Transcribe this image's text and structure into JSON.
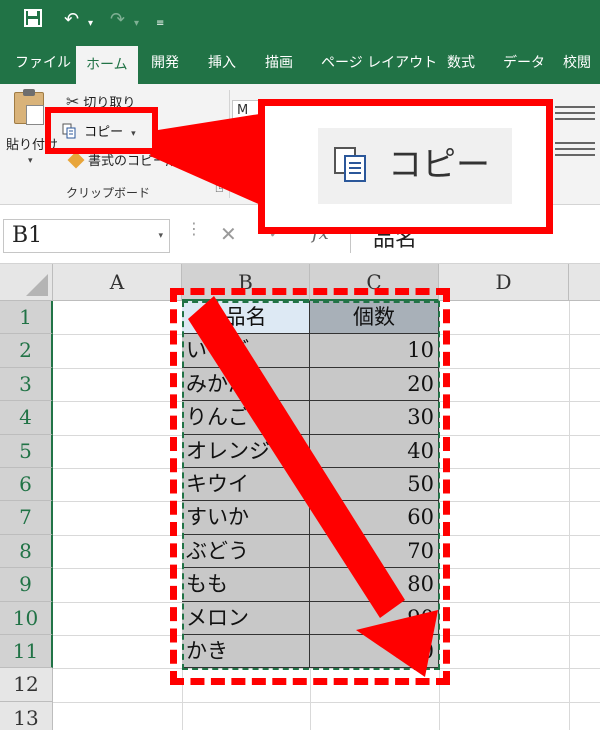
{
  "tabs": [
    "ファイル",
    "ホーム",
    "開発",
    "挿入",
    "描画",
    "ページ レイアウト",
    "数式",
    "データ",
    "校閲"
  ],
  "active_tab": "ホーム",
  "clipboard": {
    "paste_label": "貼り付け",
    "cut_label": "切り取り",
    "copy_label": "コピー",
    "format_painter_label": "書式のコピー/貼り付け",
    "group_label": "クリップボード"
  },
  "font_box_value": "M",
  "callout": {
    "zoom_label": "コピー"
  },
  "formula_bar": {
    "name_box": "B1",
    "fx": "fx",
    "content": "品名"
  },
  "columns": [
    "A",
    "B",
    "C",
    "D"
  ],
  "rows": [
    "1",
    "2",
    "3",
    "4",
    "5",
    "6",
    "7",
    "8",
    "9",
    "10",
    "11",
    "12",
    "13"
  ],
  "table": {
    "headers": [
      "品名",
      "個数"
    ],
    "rows": [
      [
        "いちご",
        "10"
      ],
      [
        "みかん",
        "20"
      ],
      [
        "りんご",
        "30"
      ],
      [
        "オレンジ",
        "40"
      ],
      [
        "キウイ",
        "50"
      ],
      [
        "すいか",
        "60"
      ],
      [
        "ぶどう",
        "70"
      ],
      [
        "もも",
        "80"
      ],
      [
        "メロン",
        "90"
      ],
      [
        "かき",
        "100"
      ]
    ]
  },
  "colors": {
    "excel_green": "#217346",
    "highlight_red": "#ff0000"
  },
  "icons": [
    "save-icon",
    "undo-icon",
    "redo-icon",
    "customize-icon",
    "copy-icon",
    "cut-icon",
    "paste-icon",
    "format-painter-icon"
  ]
}
